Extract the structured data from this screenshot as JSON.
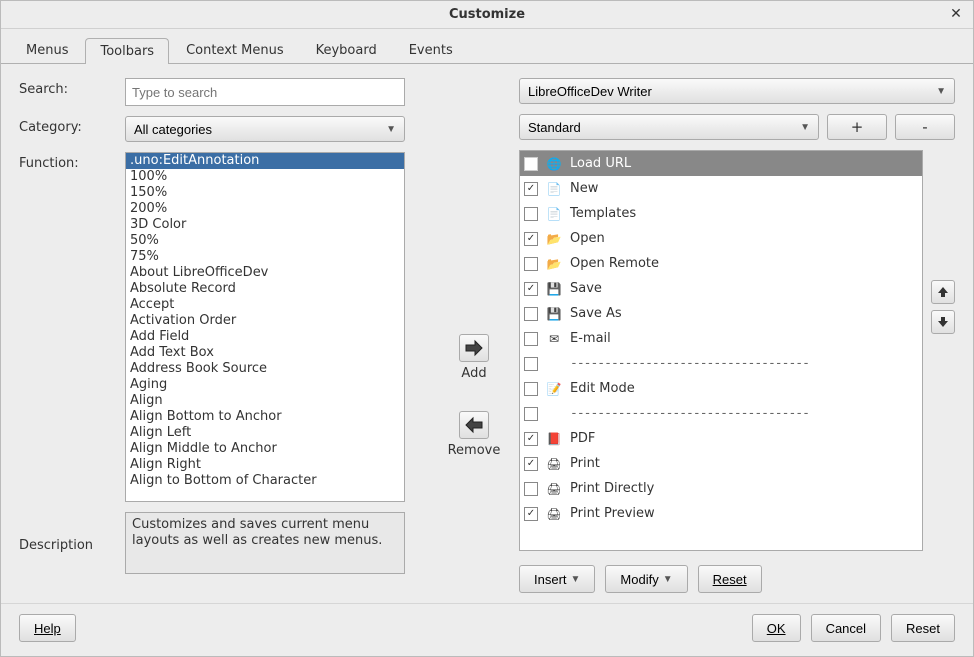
{
  "window": {
    "title": "Customize"
  },
  "tabs": [
    "Menus",
    "Toolbars",
    "Context Menus",
    "Keyboard",
    "Events"
  ],
  "active_tab": 1,
  "labels": {
    "search": "Search:",
    "category": "Category:",
    "function": "Function:",
    "description": "Description",
    "add": "Add",
    "remove": "Remove",
    "plus": "+",
    "minus": "-"
  },
  "search": {
    "placeholder": "Type to search"
  },
  "category": {
    "value": "All categories"
  },
  "function_list": [
    ".uno:EditAnnotation",
    "100%",
    "150%",
    "200%",
    "3D Color",
    "50%",
    "75%",
    "About LibreOfficeDev",
    "Absolute Record",
    "Accept",
    "Activation Order",
    "Add Field",
    "Add Text Box",
    "Address Book Source",
    "Aging",
    "Align",
    "Align Bottom to Anchor",
    "Align Left",
    "Align Middle to Anchor",
    "Align Right",
    "Align to Bottom of Character"
  ],
  "function_selected": 0,
  "description": "Customizes and saves current menu layouts as well as creates new menus.",
  "target_app": {
    "value": "LibreOfficeDev Writer"
  },
  "toolbar": {
    "value": "Standard"
  },
  "commands": [
    {
      "checked": false,
      "icon": "globe",
      "label": "Load URL",
      "header": true
    },
    {
      "checked": true,
      "icon": "doc",
      "label": "New"
    },
    {
      "checked": false,
      "icon": "doc",
      "label": "Templates"
    },
    {
      "checked": true,
      "icon": "folder",
      "label": "Open"
    },
    {
      "checked": false,
      "icon": "folder",
      "label": "Open Remote"
    },
    {
      "checked": true,
      "icon": "save",
      "label": "Save"
    },
    {
      "checked": false,
      "icon": "save",
      "label": "Save As"
    },
    {
      "checked": false,
      "icon": "mail",
      "label": "E-mail"
    },
    {
      "sep": true
    },
    {
      "checked": false,
      "icon": "edit",
      "label": "Edit Mode"
    },
    {
      "sep": true
    },
    {
      "checked": true,
      "icon": "pdf",
      "label": "PDF"
    },
    {
      "checked": true,
      "icon": "print",
      "label": "Print"
    },
    {
      "checked": false,
      "icon": "print",
      "label": "Print Directly"
    },
    {
      "checked": true,
      "icon": "print",
      "label": "Print Preview"
    }
  ],
  "buttons": {
    "insert": "Insert",
    "modify": "Modify",
    "reset_small": "Reset",
    "help": "Help",
    "ok": "OK",
    "cancel": "Cancel",
    "reset": "Reset"
  }
}
